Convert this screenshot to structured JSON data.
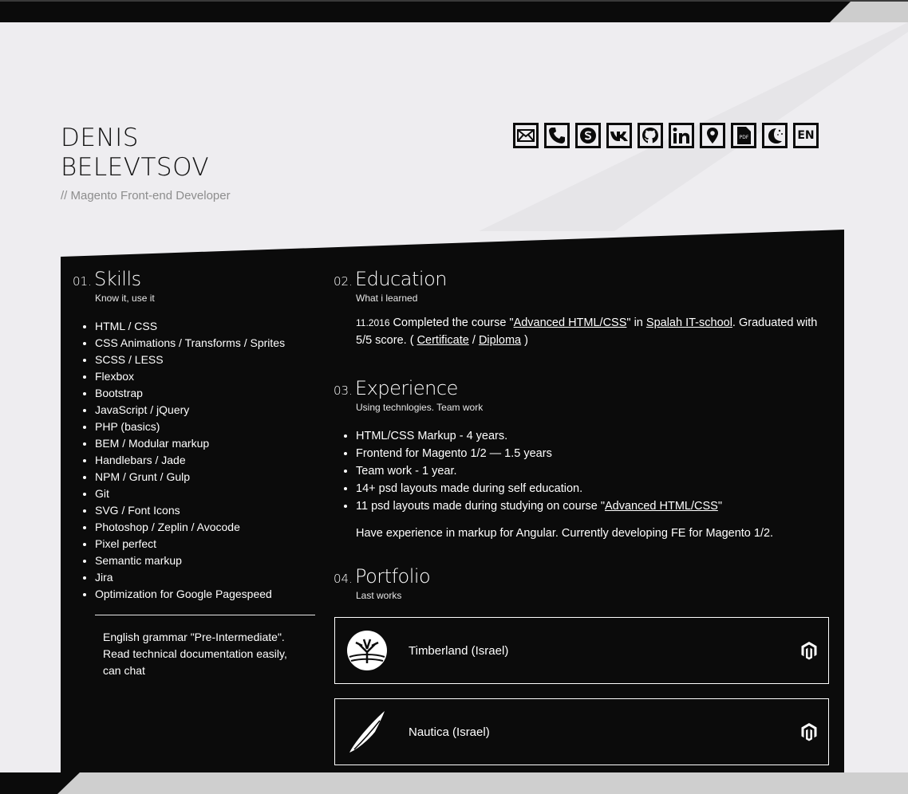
{
  "header": {
    "first_name": "DENIS",
    "last_name": "BELEVTSOV",
    "role": "// Magento Front-end Developer"
  },
  "contact_icons": [
    "mail-icon",
    "phone-icon",
    "skype-icon",
    "vk-icon",
    "github-icon",
    "linkedin-icon",
    "location-icon",
    "pdf-icon",
    "theme-toggle-icon"
  ],
  "language_label": "EN",
  "skills": {
    "num": "01.",
    "title": "Skills",
    "subtitle": "Know it, use it",
    "items": [
      "HTML / CSS",
      "CSS Animations / Transforms / Sprites",
      "SCSS / LESS",
      "Flexbox",
      "Bootstrap",
      "JavaScript / jQuery",
      "PHP (basics)",
      "BEM / Modular markup",
      "Handlebars / Jade",
      "NPM / Grunt / Gulp",
      "Git",
      "SVG / Font Icons",
      "Photoshop / Zeplin / Avocode",
      "Pixel perfect",
      "Semantic markup",
      "Jira",
      "Optimization for Google Pagespeed"
    ],
    "language_note": "English grammar \"Pre-Intermediate\". Read technical documentation easily, can chat"
  },
  "education": {
    "num": "02.",
    "title": "Education",
    "subtitle": "What i learned",
    "date": "11.2016",
    "text_before": " Completed the course \"",
    "course_link": "Advanced HTML/CSS",
    "text_mid": "\" in ",
    "school_link": "Spalah IT-school",
    "text_after": ". Graduated with 5/5 score. ( ",
    "certificate_link": "Certificate",
    "sep": " / ",
    "diploma_link": "Diploma",
    "close": " )"
  },
  "experience": {
    "num": "03.",
    "title": "Experience",
    "subtitle": "Using technlogies. Team work",
    "items": [
      "HTML/CSS Markup - 4 years.",
      "Frontend for Magento 1/2 — 1.5 years",
      "Team work - 1 year.",
      "14+ psd layouts made during self education."
    ],
    "last_item_before": "11 psd layouts made during studying on course \"",
    "last_item_link": "Advanced HTML/CSS",
    "last_item_after": "\"",
    "note": "Have experience in markup for Angular. Currently developing FE for Magento 1/2."
  },
  "portfolio": {
    "num": "04.",
    "title": "Portfolio",
    "subtitle": "Last works",
    "items": [
      {
        "name": "Timberland (Israel)",
        "logo": "timberland-tree-icon",
        "platform": "magento-icon"
      },
      {
        "name": "Nautica (Israel)",
        "logo": "nautica-sail-icon",
        "platform": "magento-icon"
      }
    ]
  },
  "colors": {
    "background": "#eeedf0",
    "panel": "#0b0b0b",
    "text_light": "#ffffff",
    "muted": "#8d8d8d"
  }
}
